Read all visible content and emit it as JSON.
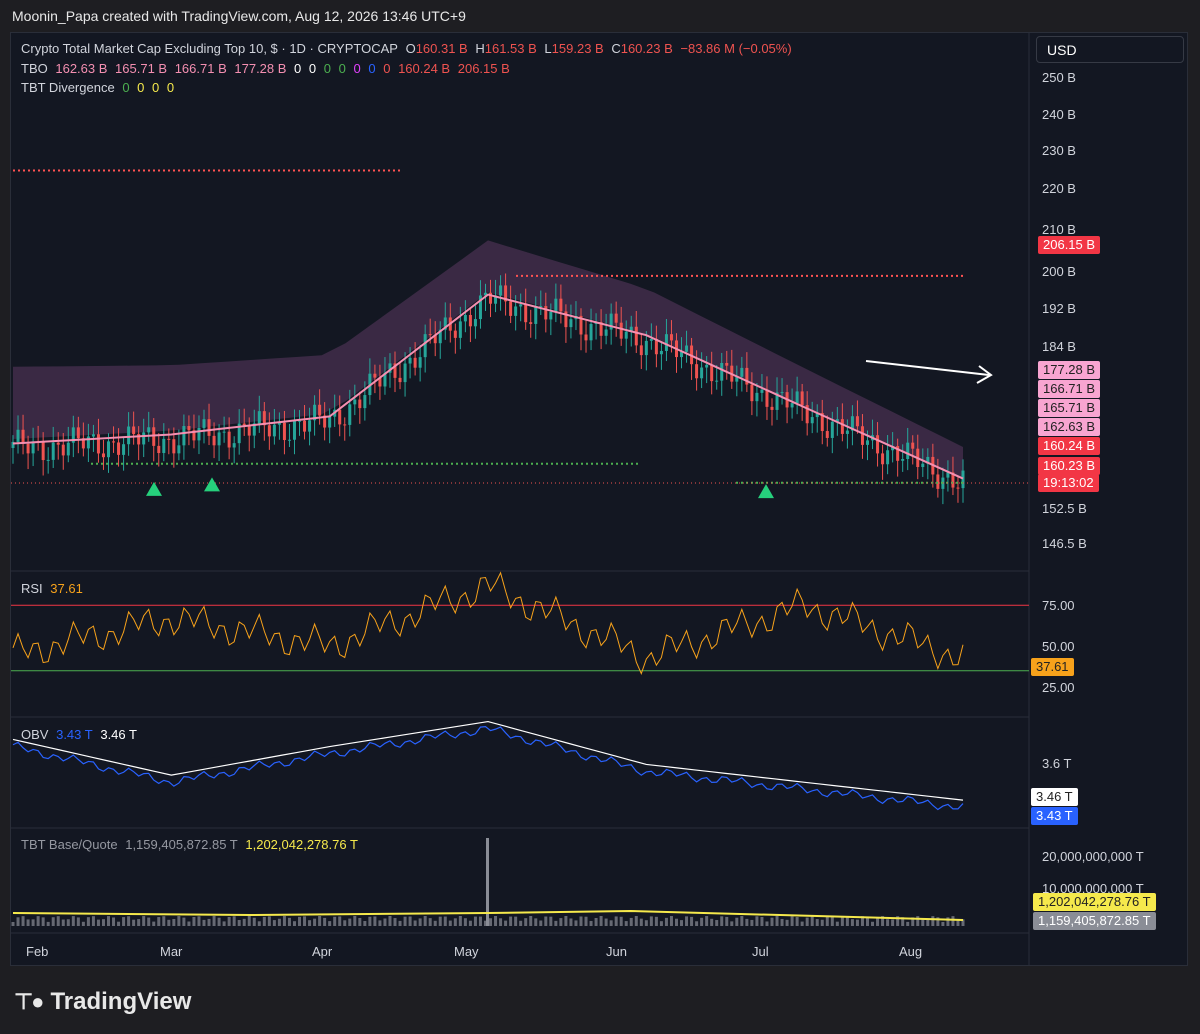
{
  "caption": "Moonin_Papa created with TradingView.com, Aug 12, 2026 13:46 UTC+9",
  "currency": "USD",
  "legend_main": {
    "title": "Crypto Total Market Cap Excluding Top 10, $ · 1D · CRYPTOCAP",
    "o_label": "O",
    "o": "160.31 B",
    "h_label": "H",
    "h": "161.53 B",
    "l_label": "L",
    "l": "159.23 B",
    "c_label": "C",
    "c": "160.23 B",
    "change": "−83.86 M (−0.05%)"
  },
  "legend_tbo": {
    "label": "TBO",
    "v1": "162.63 B",
    "v2": "165.71 B",
    "v3": "166.71 B",
    "v4": "177.28 B",
    "zeros": [
      "0",
      "0",
      "0",
      "0",
      "0",
      "0",
      "0"
    ],
    "v5": "160.24 B",
    "v6": "206.15 B"
  },
  "legend_div": {
    "label": "TBT Divergence",
    "zeros": [
      "0",
      "0",
      "0",
      "0"
    ]
  },
  "legend_rsi": {
    "label": "RSI",
    "value": "37.61"
  },
  "legend_obv": {
    "label": "OBV",
    "v1": "3.43 T",
    "v2": "3.46 T"
  },
  "legend_bq": {
    "label": "TBT Base/Quote",
    "v1": "1,159,405,872.85 T",
    "v2": "1,202,042,278.76 T"
  },
  "price_axis": [
    "250 B",
    "240 B",
    "230 B",
    "220 B",
    "210 B",
    "200 B",
    "192 B",
    "184 B",
    "152.5 B",
    "146.5 B"
  ],
  "price_tags": {
    "t206": "206.15 B",
    "t177": "177.28 B",
    "t166": "166.71 B",
    "t165": "165.71 B",
    "t162": "162.63 B",
    "t160a": "160.24 B",
    "t160b": "160.23 B",
    "countdown": "19:13:02"
  },
  "rsi_axis": [
    "75.00",
    "50.00",
    "25.00"
  ],
  "rsi_tag": "37.61",
  "obv_axis": "3.6 T",
  "obv_tags": {
    "white": "3.46 T",
    "blue": "3.43 T"
  },
  "bq_axis": [
    "20,000,000,000 T",
    "10,000,000,000 T"
  ],
  "bq_tags": {
    "yellow": "1,202,042,278.76 T",
    "gray": "1,159,405,872.85 T"
  },
  "time_axis": [
    "Feb",
    "Mar",
    "Apr",
    "May",
    "Jun",
    "Jul",
    "Aug"
  ],
  "brand": "TradingView",
  "colors": {
    "up": "#26a69a",
    "down": "#ef5350",
    "rsi": "#f7a21b",
    "obv": "#2962ff",
    "band": "#c76cc0",
    "volume_line": "#f5e94c"
  },
  "chart_data": {
    "type": "line",
    "title": "Crypto Total Market Cap Excluding Top 10, $ · 1D · CRYPTOCAP",
    "x": [
      "Feb",
      "Mar",
      "Apr",
      "May",
      "Jun",
      "Jul",
      "Aug"
    ],
    "ylabel": "",
    "series": [
      {
        "name": "Crypto Total Market Cap Excluding Top 10",
        "values": [
          168,
          170,
          174,
          201,
          192,
          176,
          160.23
        ]
      },
      {
        "name": "RSI",
        "values": [
          40,
          62,
          45,
          82,
          38,
          70,
          37.61
        ]
      },
      {
        "name": "OBV",
        "values": [
          3.6,
          3.5,
          3.58,
          3.65,
          3.53,
          3.48,
          3.43
        ]
      }
    ],
    "ylim": [
      143,
      255
    ],
    "rsi_levels": [
      75,
      50,
      25
    ],
    "key_levels": [
      206.15,
      177.28,
      166.71,
      165.71,
      162.63,
      160.24,
      160.23
    ]
  }
}
